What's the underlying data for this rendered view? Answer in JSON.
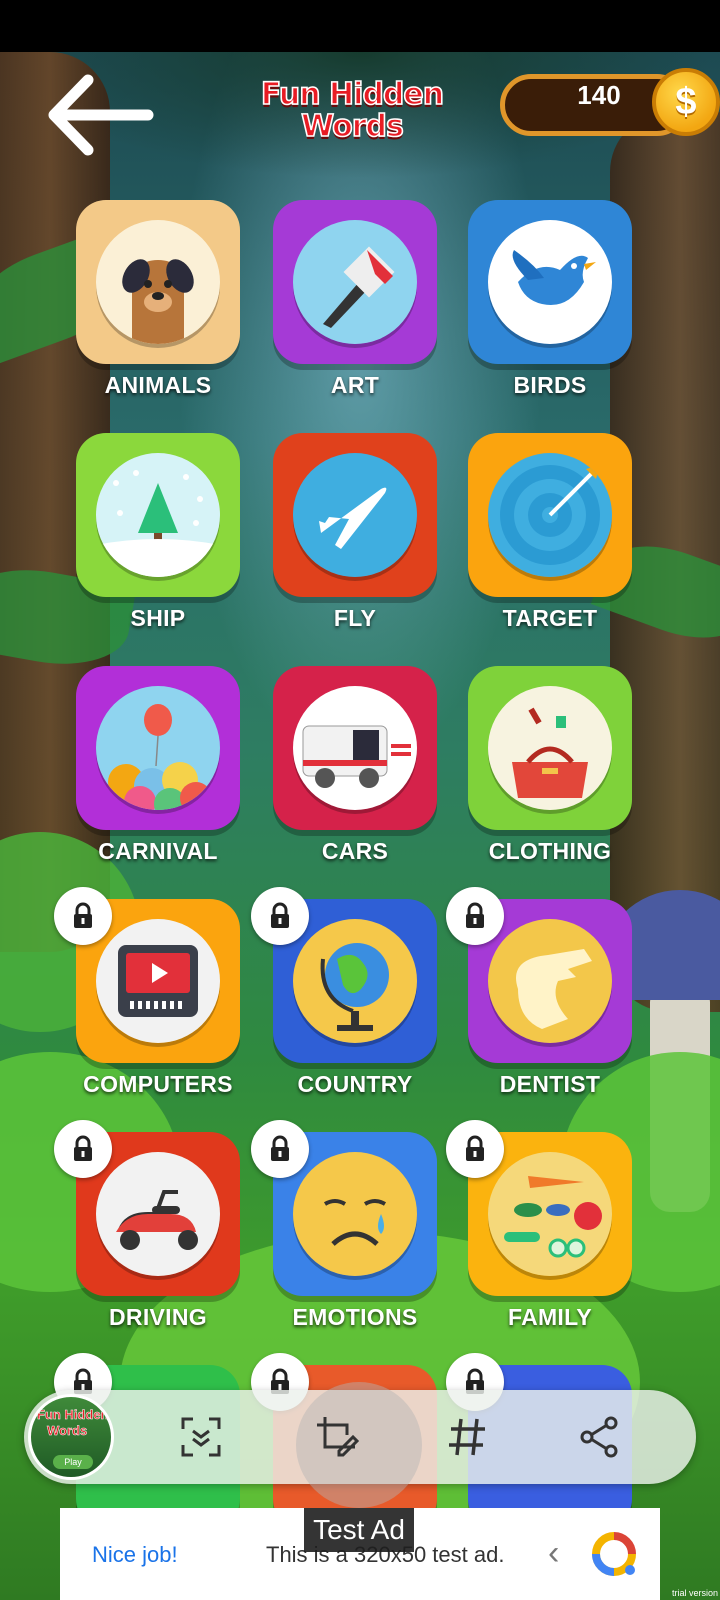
{
  "header": {
    "title_line1": "Fun Hidden",
    "title_line2": "Words",
    "coins": "140",
    "coin_symbol": "$"
  },
  "categories": [
    {
      "label": "ANIMALS",
      "color": "#f3c988",
      "locked": false,
      "icon": "dog-icon"
    },
    {
      "label": "ART",
      "color": "#a53ad6",
      "locked": false,
      "icon": "paintbrush-icon"
    },
    {
      "label": "BIRDS",
      "color": "#2f86d6",
      "locked": false,
      "icon": "bird-icon"
    },
    {
      "label": "SHIP",
      "color": "#8bd83c",
      "locked": false,
      "icon": "snow-globe-icon"
    },
    {
      "label": "FLY",
      "color": "#e0411c",
      "locked": false,
      "icon": "airplane-icon"
    },
    {
      "label": "TARGET",
      "color": "#fba40e",
      "locked": false,
      "icon": "target-icon"
    },
    {
      "label": "CARNIVAL",
      "color": "#b22fd8",
      "locked": false,
      "icon": "balloons-icon"
    },
    {
      "label": "CARS",
      "color": "#d5224a",
      "locked": false,
      "icon": "ambulance-icon"
    },
    {
      "label": "CLOTHING",
      "color": "#7fd23a",
      "locked": false,
      "icon": "handbag-icon"
    },
    {
      "label": "COMPUTERS",
      "color": "#fba40e",
      "locked": true,
      "icon": "tv-icon"
    },
    {
      "label": "COUNTRY",
      "color": "#2f5fd6",
      "locked": true,
      "icon": "globe-icon"
    },
    {
      "label": "DENTIST",
      "color": "#a53ad6",
      "locked": true,
      "icon": "dinosaur-icon"
    },
    {
      "label": "DRIVING",
      "color": "#e0391c",
      "locked": true,
      "icon": "scooter-icon"
    },
    {
      "label": "EMOTIONS",
      "color": "#3a82e8",
      "locked": true,
      "icon": "sad-face-icon"
    },
    {
      "label": "FAMILY",
      "color": "#fbb30e",
      "locked": true,
      "icon": "vegetables-icon"
    }
  ],
  "partial_row": [
    {
      "color": "#2fbf4a",
      "locked": true
    },
    {
      "color": "#e85a2a",
      "locked": true
    },
    {
      "color": "#3a5ee0",
      "locked": true
    }
  ],
  "toolbar": {
    "thumb_title_line1": "Fun Hidden",
    "thumb_title_line2": "Words",
    "thumb_play": "Play"
  },
  "ad": {
    "nice": "Nice job!",
    "text": "This is a 320x50 test ad.",
    "badge": "Test Ad"
  },
  "watermark": "trial version"
}
